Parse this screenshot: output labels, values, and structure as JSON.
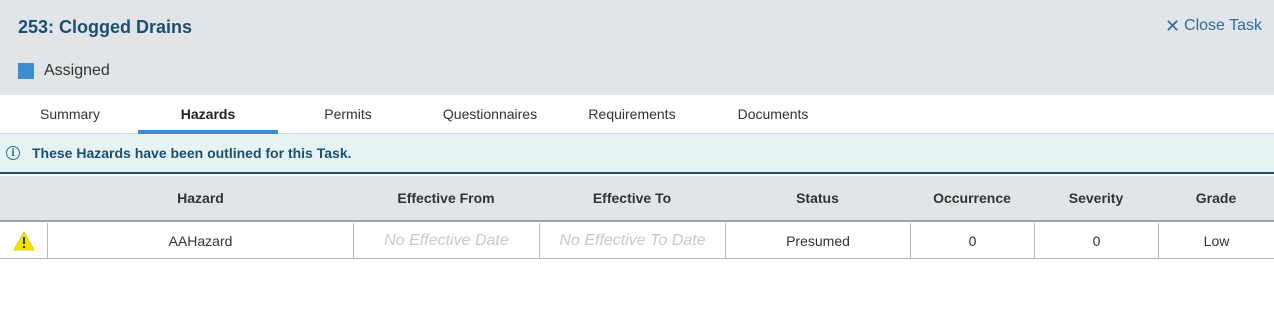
{
  "task": {
    "title": "253: Clogged Drains",
    "close_label": "Close Task",
    "status_label": "Assigned",
    "status_color": "#3c8dcf"
  },
  "tabs": [
    {
      "label": "Summary",
      "active": false
    },
    {
      "label": "Hazards",
      "active": true
    },
    {
      "label": "Permits",
      "active": false
    },
    {
      "label": "Questionnaires",
      "active": false
    },
    {
      "label": "Requirements",
      "active": false
    },
    {
      "label": "Documents",
      "active": false
    }
  ],
  "info": {
    "icon": "info-icon",
    "message": "These Hazards have been outlined for this Task."
  },
  "table": {
    "columns": [
      "Hazard",
      "Effective From",
      "Effective To",
      "Status",
      "Occurrence",
      "Severity",
      "Grade"
    ],
    "rows": [
      {
        "icon": "warning-icon",
        "hazard": "AAHazard",
        "effective_from": "No Effective Date",
        "effective_to": "No Effective To Date",
        "status": "Presumed",
        "occurrence": "0",
        "severity": "0",
        "grade": "Low"
      }
    ]
  },
  "colors": {
    "accent": "#3c8dcf",
    "title": "#1c4f6e",
    "warning": "#f2e600"
  }
}
